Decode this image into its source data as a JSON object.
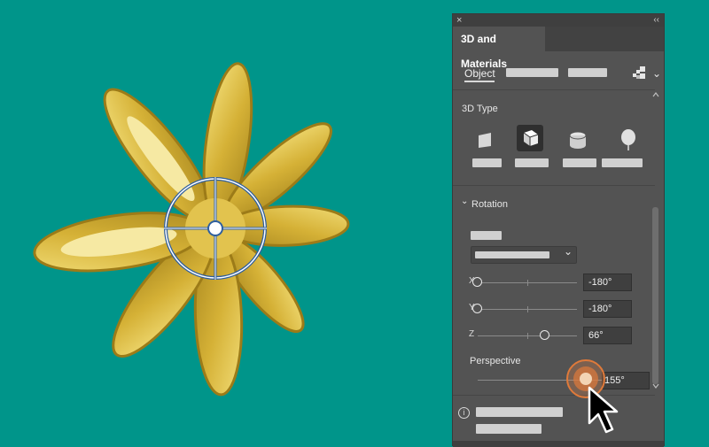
{
  "panel": {
    "close_glyph": "×",
    "collapse_glyph": "‹‹",
    "tab_title": "3D and Materials",
    "subtab_active": "Object",
    "section_3d_type": "3D Type",
    "section_rotation": "Rotation",
    "expand_glyph": "⌄",
    "rotation": {
      "x_label": "X",
      "x_value": "-180°",
      "x_level": 0.0,
      "y_label": "Y",
      "y_value": "-180°",
      "y_level": 0.0,
      "z_label": "Z",
      "z_value": "66°",
      "z_level": 0.68
    },
    "perspective_label": "Perspective",
    "perspective_value": "155°",
    "perspective_level": 0.86,
    "info_glyph": "i"
  },
  "colors": {
    "canvas_bg": "#00958a",
    "panel_bg": "#535353",
    "flower": "#d9b53a",
    "highlight": "#e07a3a"
  },
  "icons": {
    "type_plane": "plane-icon",
    "type_extrude": "extrude-icon",
    "type_revolve": "revolve-icon",
    "type_inflate": "inflate-icon",
    "gradient": "gradient-icon",
    "pointer": "arrow-cursor-icon"
  }
}
